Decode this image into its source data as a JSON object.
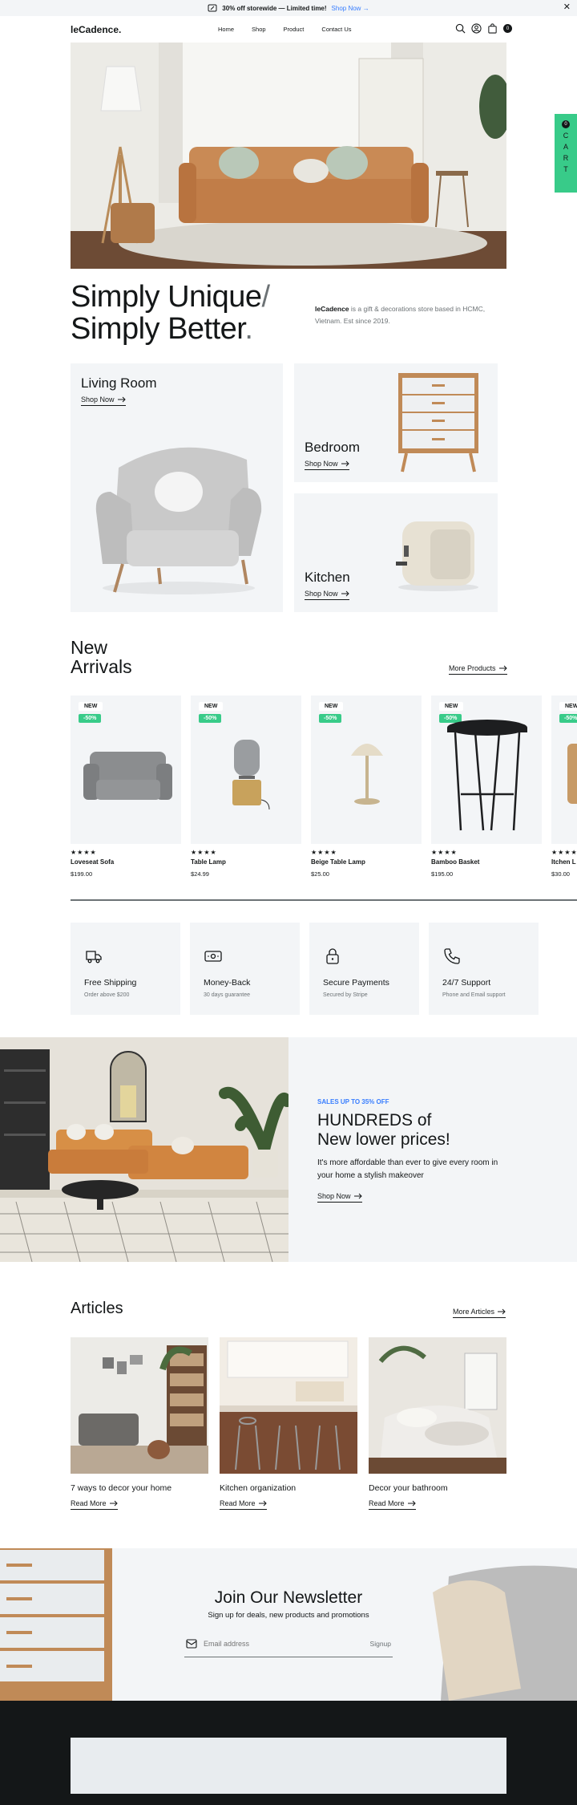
{
  "promo_bar": {
    "text": "30% off storewide — Limited time!",
    "link": "Shop Now",
    "close": "✕"
  },
  "nav": {
    "logo": "leCadence.",
    "links": [
      "Home",
      "Shop",
      "Product",
      "Contact Us"
    ],
    "icons": [
      "search-icon",
      "user-icon",
      "bag-icon"
    ],
    "cart_count": "0"
  },
  "side_cart": {
    "count": "0",
    "label": [
      "C",
      "A",
      "R",
      "T"
    ]
  },
  "hero": {
    "headline_1": "Simply Unique",
    "headline_1_suffix": "/",
    "headline_2": "Simply Better",
    "headline_2_suffix": ".",
    "brand": "leCadence",
    "tagline": " is a gift & decorations store based in HCMC, Vietnam. Est since 2019."
  },
  "categories": [
    {
      "title": "Living Room",
      "link": "Shop Now"
    },
    {
      "title": "Bedroom",
      "link": "Shop Now"
    },
    {
      "title": "Kitchen",
      "link": "Shop Now"
    }
  ],
  "arrivals": {
    "title_1": "New",
    "title_2": "Arrivals",
    "more": "More Products",
    "products": [
      {
        "badge": "NEW",
        "discount": "-50%",
        "stars": "★★★★",
        "name": "Loveseat Sofa",
        "price": "$199.00"
      },
      {
        "badge": "NEW",
        "discount": "-50%",
        "stars": "★★★★",
        "name": "Table Lamp",
        "price": "$24.99"
      },
      {
        "badge": "NEW",
        "discount": "-50%",
        "stars": "★★★★",
        "name": "Beige Table Lamp",
        "price": "$25.00"
      },
      {
        "badge": "NEW",
        "discount": "-50%",
        "stars": "★★★★",
        "name": "Bamboo Basket",
        "price": "$195.00"
      },
      {
        "badge": "NEW",
        "discount": "-50%",
        "stars": "★★★★",
        "name": "Itchen L",
        "price": "$30.00"
      }
    ]
  },
  "features": [
    {
      "icon": "truck-icon",
      "title": "Free Shipping",
      "sub": "Order above $200"
    },
    {
      "icon": "money-icon",
      "title": "Money-Back",
      "sub": "30 days guarantee"
    },
    {
      "icon": "lock-icon",
      "title": "Secure Payments",
      "sub": "Secured by Stripe"
    },
    {
      "icon": "phone-icon",
      "title": "24/7 Support",
      "sub": "Phone and Email support"
    }
  ],
  "promo": {
    "eyebrow": "SALES UP TO 35% OFF",
    "title_1": "HUNDREDS of",
    "title_2": "New lower prices!",
    "desc": "It's more affordable than ever to give every room in your home a stylish makeover",
    "link": "Shop Now"
  },
  "articles": {
    "title": "Articles",
    "more": "More Articles",
    "items": [
      {
        "title": "7 ways to decor your home",
        "link": "Read More"
      },
      {
        "title": "Kitchen organization",
        "link": "Read More"
      },
      {
        "title": "Decor your bathroom",
        "link": "Read More"
      }
    ]
  },
  "newsletter": {
    "title": "Join Our Newsletter",
    "sub": "Sign up for deals, new products and promotions",
    "placeholder": "Email address",
    "button": "Signup"
  },
  "colors": {
    "accent_green": "#38cb89",
    "accent_blue": "#377dff",
    "dark": "#141718",
    "light_gray": "#f3f5f7"
  }
}
